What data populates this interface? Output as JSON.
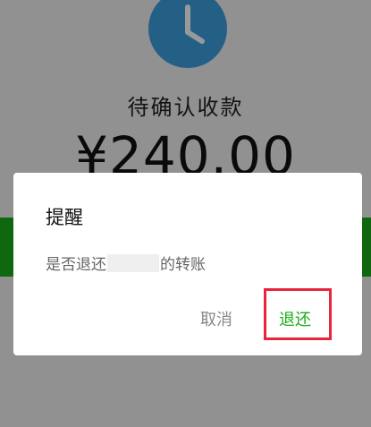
{
  "background": {
    "status_title": "待确认收款",
    "amount": "¥240.00"
  },
  "dialog": {
    "title": "提醒",
    "message_prefix": "是否退还",
    "message_suffix": "的转账",
    "cancel_label": "取消",
    "return_label": "退还"
  },
  "colors": {
    "accent_green": "#1aad19",
    "clock_blue": "#3d9fe0",
    "highlight_red": "#e8253a"
  },
  "icons": {
    "clock": "clock-icon"
  }
}
